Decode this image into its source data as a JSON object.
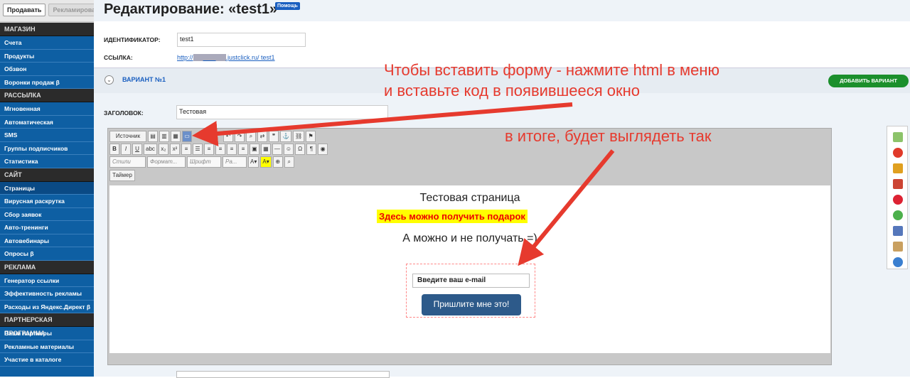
{
  "sidebar": {
    "top_buttons": [
      "Продавать",
      "Рекламировать"
    ],
    "sections": [
      {
        "title": "МАГАЗИН",
        "items": [
          "Счета",
          "Продукты",
          "Обзвон",
          "Воронки продаж β"
        ]
      },
      {
        "title": "РАССЫЛКА",
        "items": [
          "Мгновенная",
          "Автоматическая",
          "SMS",
          "Группы подписчиков",
          "Статистика"
        ]
      },
      {
        "title": "САЙТ",
        "items": [
          "Страницы",
          "Вирусная раскрутка",
          "Сбор заявок",
          "Авто-тренинги",
          "Автовебинары",
          "Опросы β"
        ]
      },
      {
        "title": "РЕКЛАМА",
        "items": [
          "Генератор ссылки",
          "Эффективность рекламы",
          "Расходы из Яндекс.Директ β"
        ]
      },
      {
        "title": "ПАРТНЕРСКАЯ ПРОГРАММА",
        "items": [
          "Ваши партнеры",
          "Рекламные материалы",
          "Участие в каталоге"
        ]
      }
    ]
  },
  "header": {
    "title": "Редактирование: «test1»",
    "help": "Помощь"
  },
  "form": {
    "id_label": "ИДЕНТИФИКАТОР:",
    "id_value": "test1",
    "link_label": "ССЫЛКА:",
    "link_prefix": "http://",
    "link_suffix": ".justclick.ru/ test1",
    "variant_title": "ВАРИАНТ №1",
    "add_variant": "ДОБАВИТЬ ВАРИАНТ",
    "heading_label": "ЗАГОЛОВОК:",
    "heading_value": "Тестовая"
  },
  "editor": {
    "source_btn": "Источник",
    "styles": "Стили",
    "format": "Формат...",
    "font": "Шрифт",
    "size": "Ра...",
    "timer_btn": "Таймер",
    "content": {
      "line1": "Тестовая страница",
      "line2": "Здесь можно получить подарок",
      "line3": "А можно и не получать =)",
      "email_placeholder": "Введите ваш e-mail",
      "submit": "Пришлите мне это!"
    }
  },
  "annotations": {
    "note1_line1": "Чтобы вставить форму - нажмите html в меню",
    "note1_line2": "и вставьте код в появившееся окно",
    "note2": "в итоге, будет выглядеть так"
  },
  "colors": {
    "sidebar": "#0e5fa3",
    "annotation": "#e63a2e",
    "add_variant": "#1b8f2c"
  }
}
